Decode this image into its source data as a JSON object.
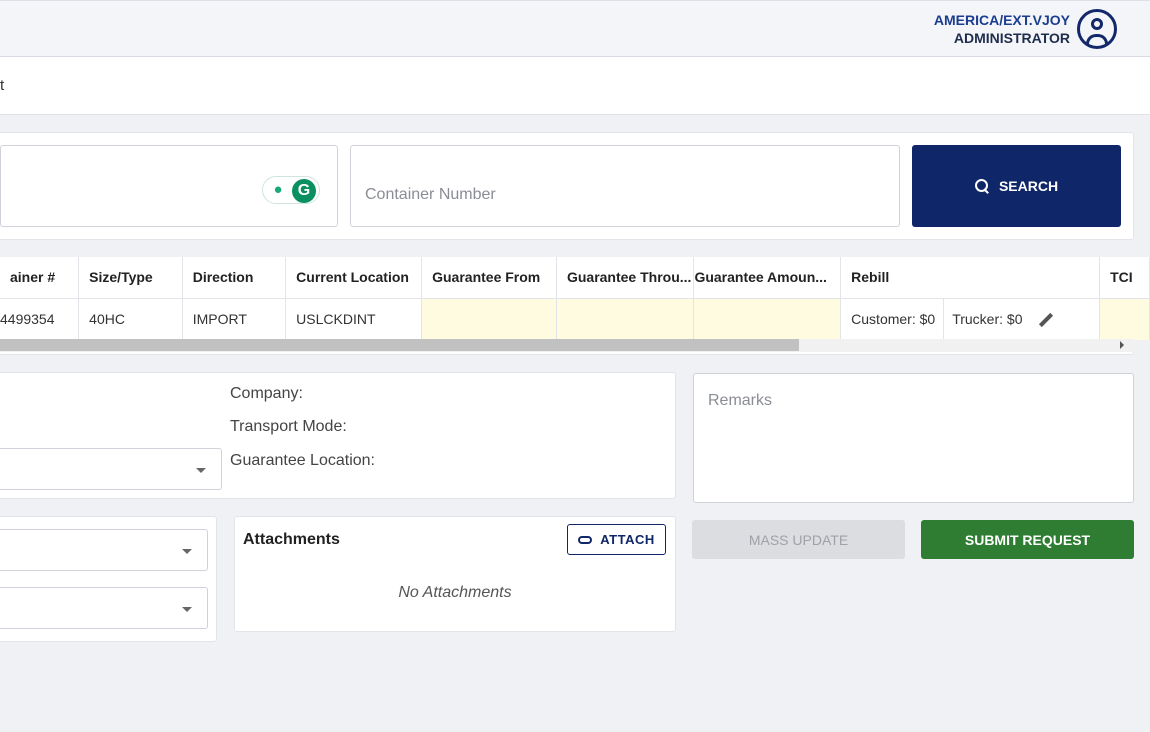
{
  "header": {
    "user_name": "AMERICA/EXT.VJOY",
    "user_role": "ADMINISTRATOR",
    "avatar_icon": "account-circle-icon"
  },
  "subbar": {
    "crumb": "t"
  },
  "search": {
    "container_placeholder": "Container Number",
    "container_value": "",
    "search_label": "SEARCH"
  },
  "table": {
    "columns": [
      "ainer #",
      "Size/Type",
      "Direction",
      "Current Location",
      "Guarantee From",
      "Guarantee Throu...",
      "Guarantee Amoun...",
      "Rebill",
      "TCI"
    ],
    "rows": [
      {
        "container": "4499354",
        "size_type": "40HC",
        "direction": "IMPORT",
        "current_location": "USLCKDINT",
        "guarantee_from": "",
        "guarantee_through": "",
        "guarantee_amount": "",
        "rebill_customer": "Customer: $0",
        "rebill_trucker": "Trucker: $0",
        "tci": ""
      }
    ],
    "highlight_color": "#fffbe0"
  },
  "info": {
    "company_label": "Company:",
    "transport_label": "Transport Mode:",
    "guarantee_location_label": "Guarantee Location:"
  },
  "remarks": {
    "placeholder": "Remarks",
    "value": ""
  },
  "attachments": {
    "title": "Attachments",
    "attach_label": "ATTACH",
    "empty_text": "No Attachments"
  },
  "actions": {
    "mass_update_label": "MASS UPDATE",
    "submit_label": "SUBMIT REQUEST"
  },
  "colors": {
    "primary": "#0f2669",
    "success": "#2e7d32",
    "disabled": "#dcdde0"
  }
}
